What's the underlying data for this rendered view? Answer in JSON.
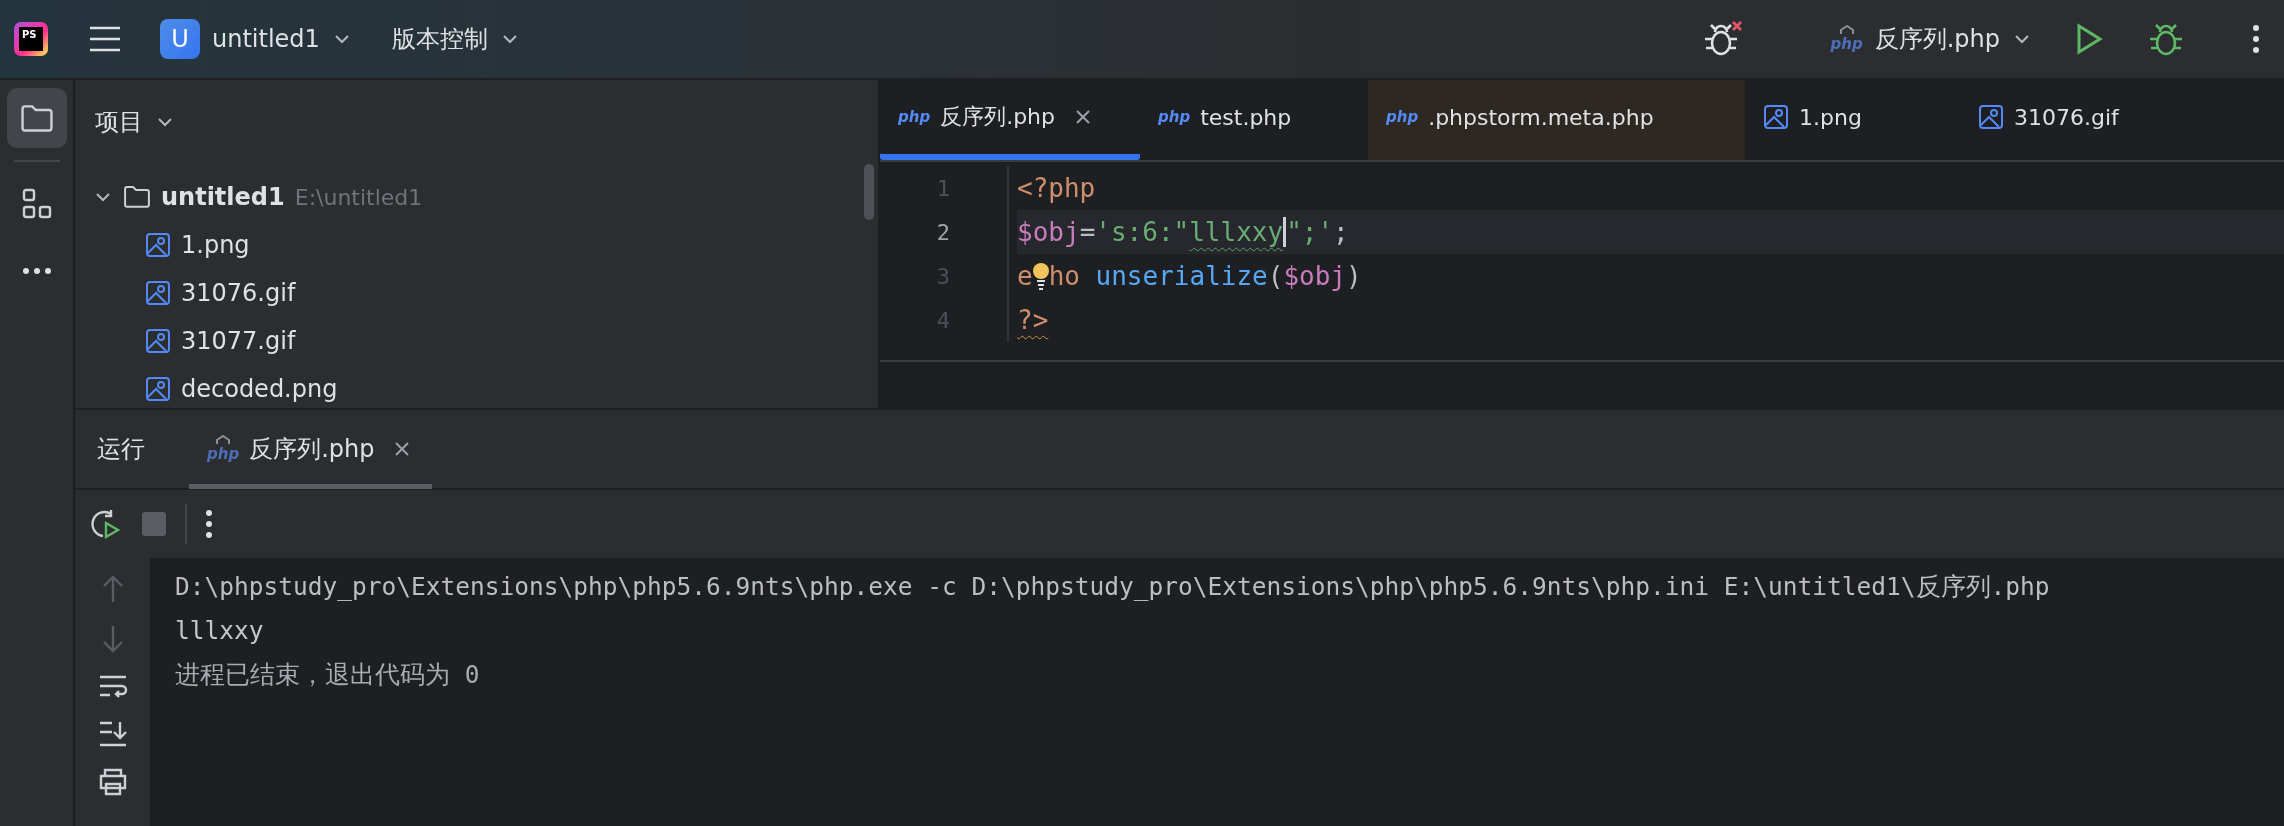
{
  "toolbar": {
    "logo": "PS",
    "project_initial": "U",
    "project": "untitled1",
    "vcs": "版本控制",
    "run_config": {
      "badge": "php",
      "label": "反序列.php"
    }
  },
  "project_panel": {
    "title": "项目",
    "tree": [
      {
        "label": "untitled1",
        "hint": "E:\\untitled1",
        "kind": "folder",
        "expanded": true,
        "children": [
          {
            "label": "1.png",
            "kind": "image"
          },
          {
            "label": "31076.gif",
            "kind": "image"
          },
          {
            "label": "31077.gif",
            "kind": "image"
          },
          {
            "label": "decoded.png",
            "kind": "image"
          }
        ]
      }
    ]
  },
  "editor": {
    "tabs": [
      {
        "label": "反序列.php",
        "kind": "php",
        "badge": "php",
        "selected": true,
        "closable": true,
        "external": false
      },
      {
        "label": "test.php",
        "kind": "php",
        "badge": "php",
        "selected": false,
        "closable": false,
        "external": false
      },
      {
        "label": ".phpstorm.meta.php",
        "kind": "php",
        "badge": "php",
        "selected": false,
        "closable": false,
        "external": true
      },
      {
        "label": "1.png",
        "kind": "image",
        "selected": false,
        "closable": false,
        "external": false
      },
      {
        "label": "31076.gif",
        "kind": "image",
        "selected": false,
        "closable": false,
        "external": false
      }
    ],
    "lines": [
      {
        "number": "1",
        "current": false,
        "tokens": [
          {
            "text": "<?php",
            "kind": "keyword"
          }
        ]
      },
      {
        "number": "2",
        "current": true,
        "tokens": [
          {
            "text": "$obj",
            "kind": "variable"
          },
          {
            "text": "=",
            "kind": "plain"
          },
          {
            "text": "'s:6:\"",
            "kind": "string"
          },
          {
            "text": "lllxxy",
            "kind": "string",
            "typo": true
          },
          {
            "kind": "caret"
          },
          {
            "text": "\";'",
            "kind": "string"
          },
          {
            "text": ";",
            "kind": "plain"
          }
        ]
      },
      {
        "number": "3",
        "current": false,
        "tokens": [
          {
            "text": "e",
            "kind": "keyword"
          },
          {
            "kind": "bulb"
          },
          {
            "text": "ho",
            "kind": "keyword"
          },
          {
            "text": "unserialize",
            "kind": "function",
            "space_before": true
          },
          {
            "text": "(",
            "kind": "plain"
          },
          {
            "text": "$obj",
            "kind": "variable"
          },
          {
            "text": ")",
            "kind": "plain"
          }
        ]
      },
      {
        "number": "4",
        "current": false,
        "tokens": [
          {
            "text": "?>",
            "kind": "keyword",
            "warning": true
          }
        ]
      }
    ]
  },
  "run_panel": {
    "title": "运行",
    "tabs": [
      {
        "label": "反序列.php",
        "badge": "php",
        "selected": true,
        "closable": true
      }
    ],
    "console": [
      {
        "text": "D:\\phpstudy_pro\\Extensions\\php\\php5.6.9nts\\php.exe -c D:\\phpstudy_pro\\Extensions\\php\\php5.6.9nts\\php.ini E:\\untitled1\\反序列.php",
        "kind": "command"
      },
      {
        "text": "lllxxy",
        "kind": "output"
      },
      {
        "text": "进程已结束，退出代码为 0",
        "kind": "exit"
      }
    ]
  }
}
